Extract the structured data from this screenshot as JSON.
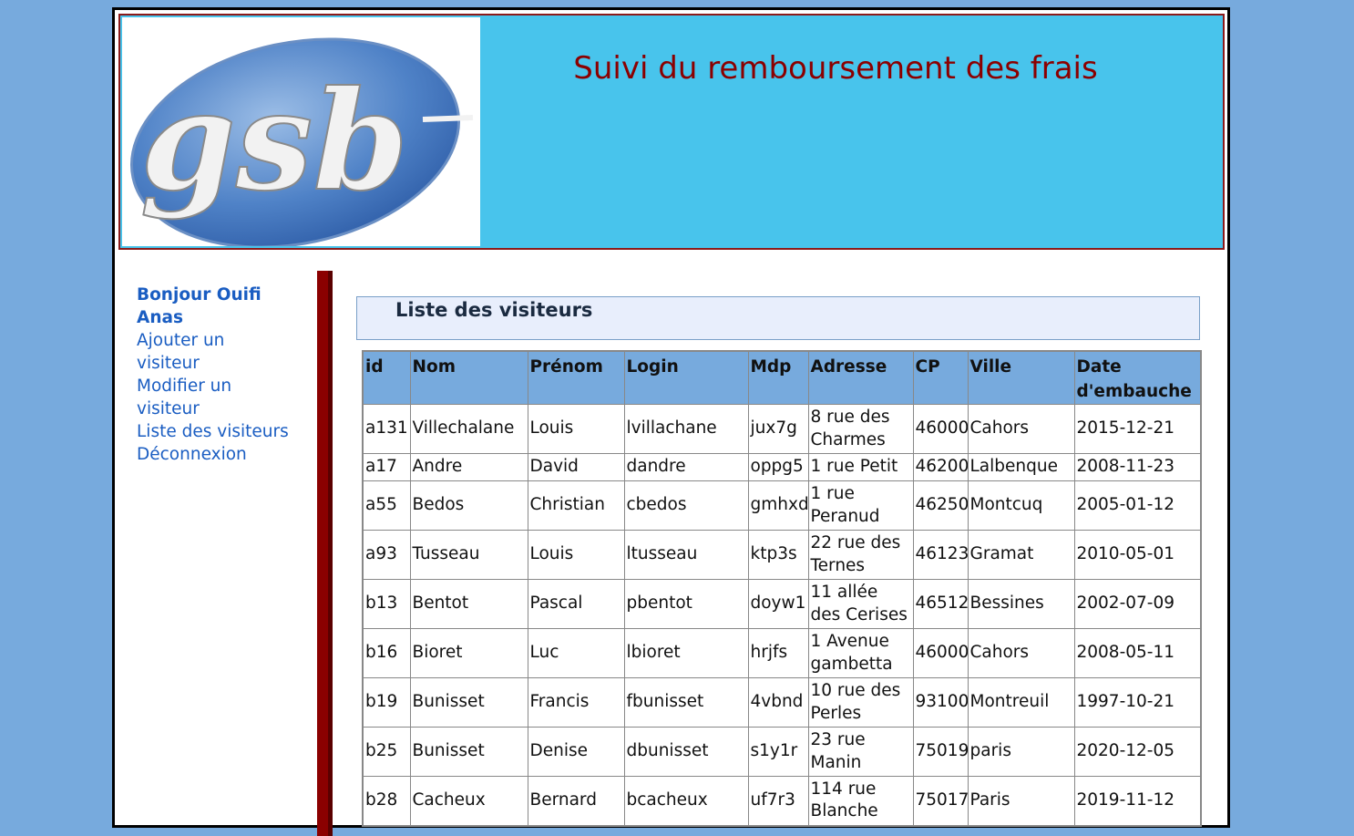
{
  "header": {
    "title": "Suivi du remboursement des frais",
    "logo_text": "gsb"
  },
  "menu": {
    "greeting": "Bonjour Ouifi Anas",
    "items": [
      {
        "label": "Ajouter un visiteur"
      },
      {
        "label": "Modifier un visiteur"
      },
      {
        "label": "Liste des visiteurs"
      },
      {
        "label": "Déconnexion"
      }
    ]
  },
  "content": {
    "heading": "Liste des visiteurs"
  },
  "table": {
    "columns": [
      "id",
      "Nom",
      "Prénom",
      "Login",
      "Mdp",
      "Adresse",
      "CP",
      "Ville",
      "Date d'embauche"
    ],
    "rows": [
      [
        "a131",
        "Villechalane",
        "Louis",
        "lvillachane",
        "jux7g",
        "8 rue des Charmes",
        "46000",
        "Cahors",
        "2015-12-21"
      ],
      [
        "a17",
        "Andre",
        "David",
        "dandre",
        "oppg5",
        "1 rue Petit",
        "46200",
        "Lalbenque",
        "2008-11-23"
      ],
      [
        "a55",
        "Bedos",
        "Christian",
        "cbedos",
        "gmhxd",
        "1 rue Peranud",
        "46250",
        "Montcuq",
        "2005-01-12"
      ],
      [
        "a93",
        "Tusseau",
        "Louis",
        "ltusseau",
        "ktp3s",
        "22 rue des Ternes",
        "46123",
        "Gramat",
        "2010-05-01"
      ],
      [
        "b13",
        "Bentot",
        "Pascal",
        "pbentot",
        "doyw1",
        "11 allée des Cerises",
        "46512",
        "Bessines",
        "2002-07-09"
      ],
      [
        "b16",
        "Bioret",
        "Luc",
        "lbioret",
        "hrjfs",
        "1 Avenue gambetta",
        "46000",
        "Cahors",
        "2008-05-11"
      ],
      [
        "b19",
        "Bunisset",
        "Francis",
        "fbunisset",
        "4vbnd",
        "10 rue des Perles",
        "93100",
        "Montreuil",
        "1997-10-21"
      ],
      [
        "b25",
        "Bunisset",
        "Denise",
        "dbunisset",
        "s1y1r",
        "23 rue Manin",
        "75019",
        "paris",
        "2020-12-05"
      ],
      [
        "b28",
        "Cacheux",
        "Bernard",
        "bcacheux",
        "uf7r3",
        "114 rue Blanche",
        "75017",
        "Paris",
        "2019-11-12"
      ]
    ]
  }
}
